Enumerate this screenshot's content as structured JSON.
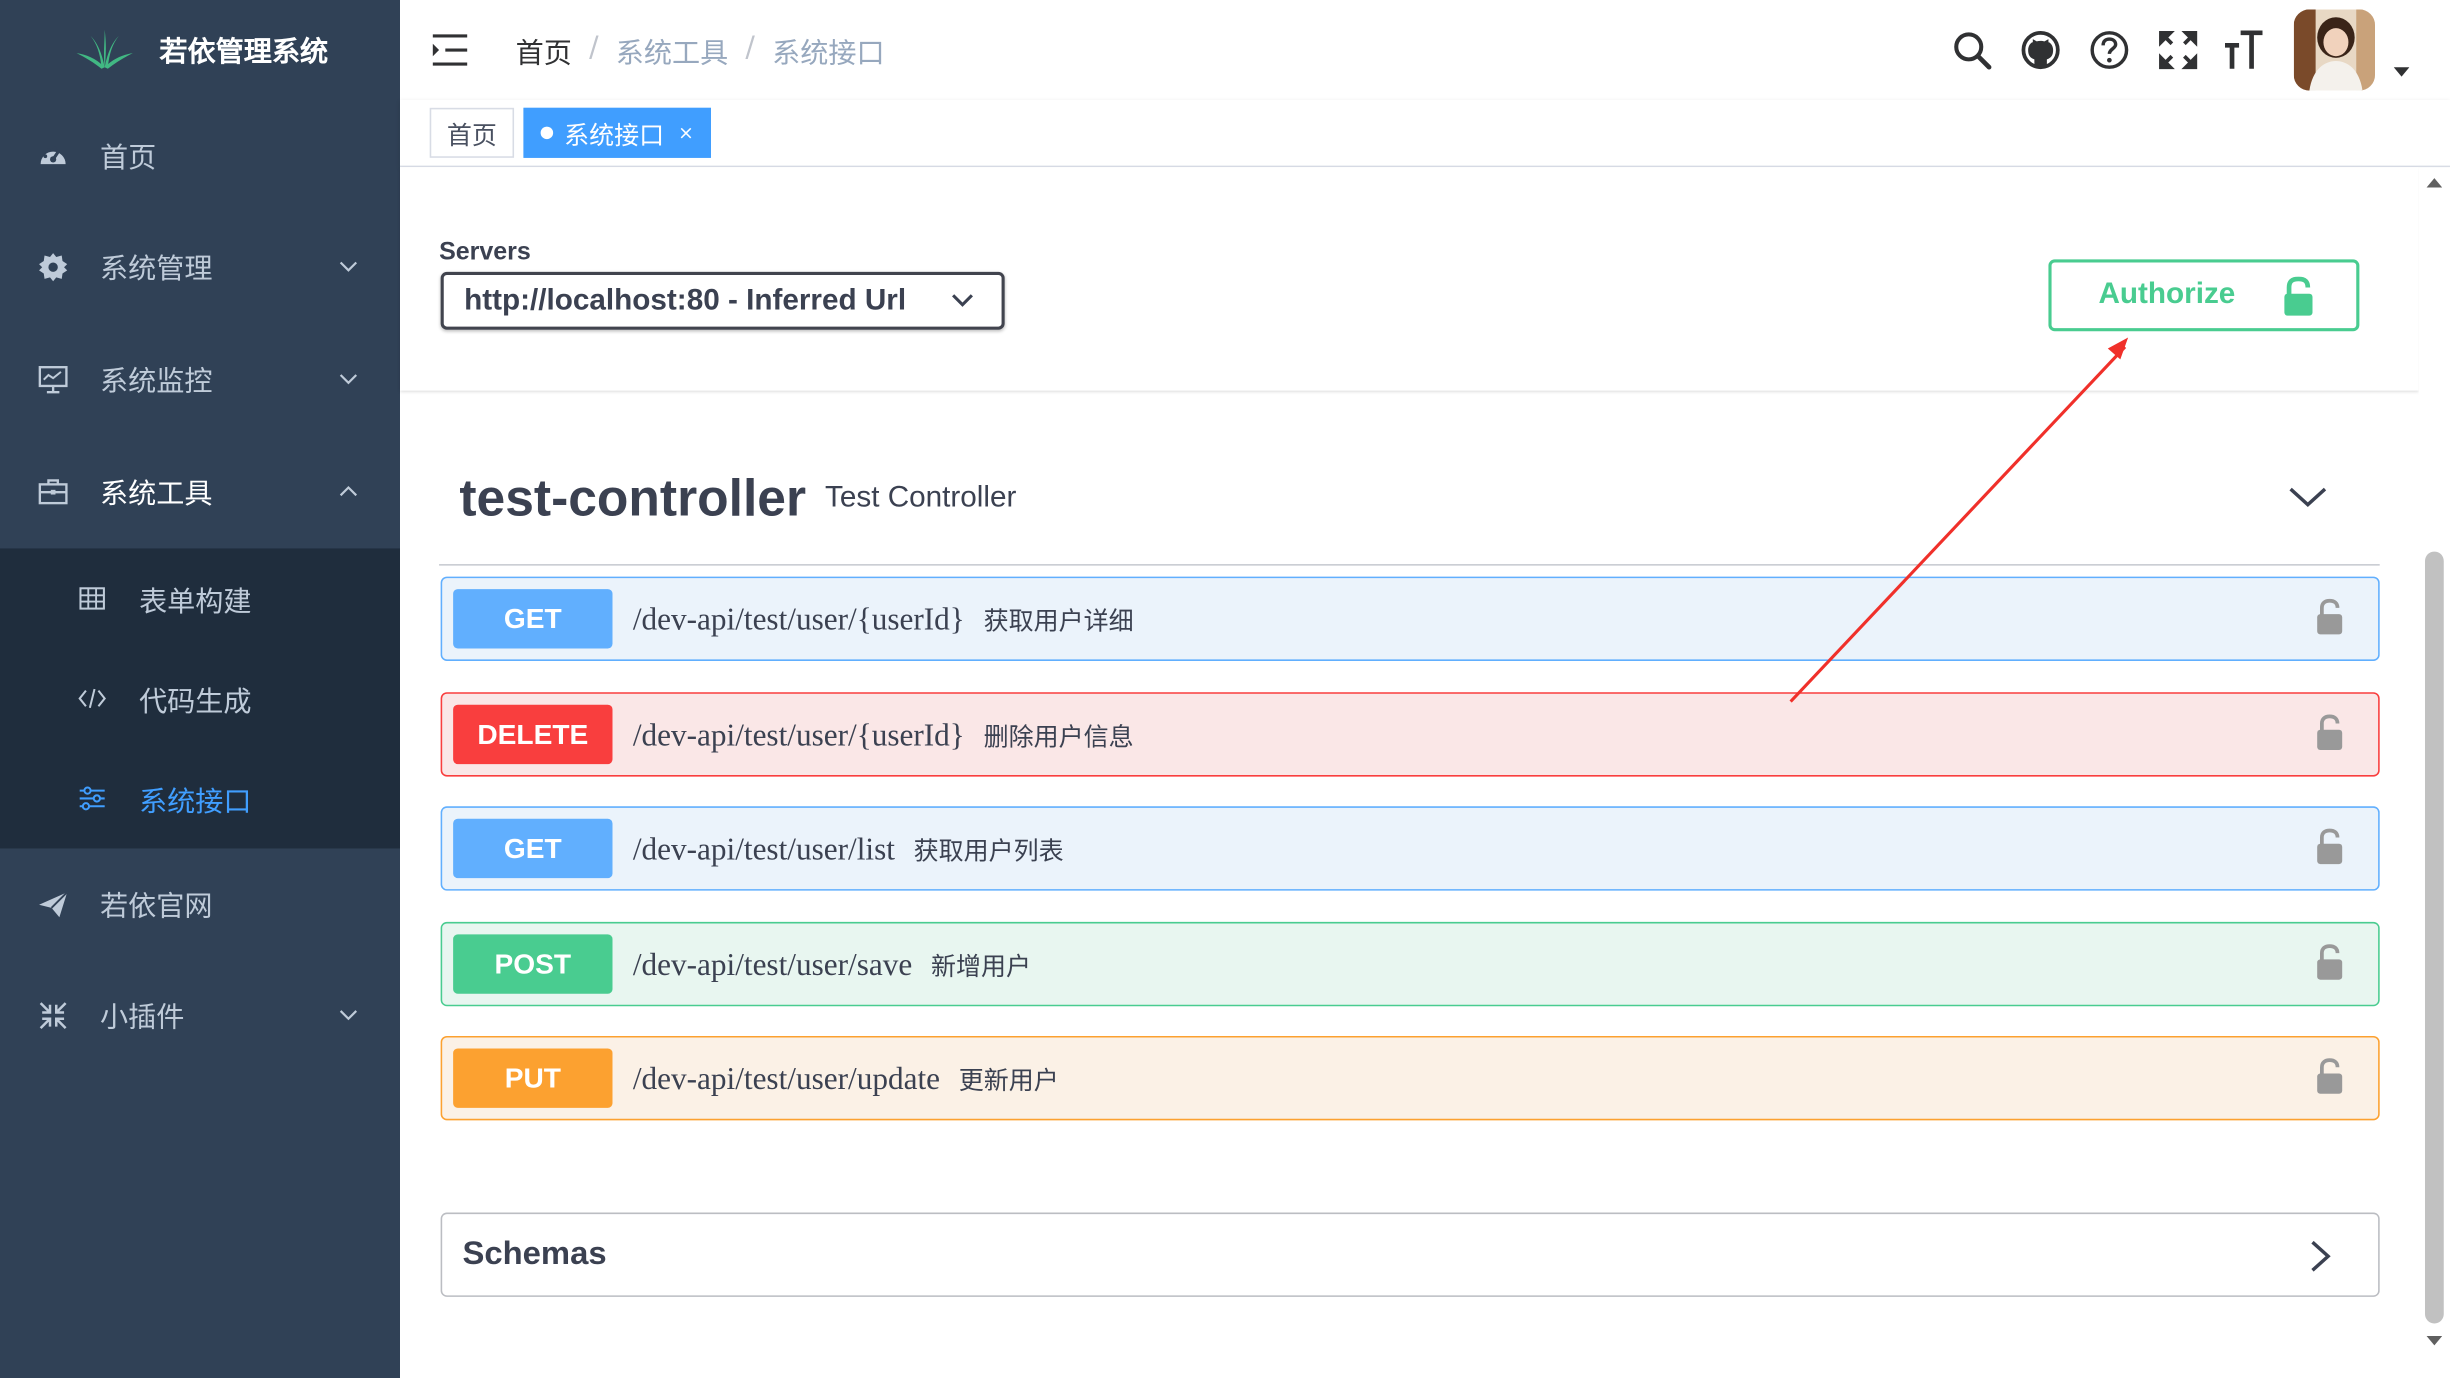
{
  "app": {
    "title": "若依管理系统"
  },
  "sidebar": {
    "items": [
      {
        "label": "首页",
        "icon": "dashboard-icon"
      },
      {
        "label": "系统管理",
        "icon": "gear-icon"
      },
      {
        "label": "系统监控",
        "icon": "monitor-icon"
      },
      {
        "label": "系统工具",
        "icon": "toolbox-icon"
      },
      {
        "label": "若依官网",
        "icon": "paper-plane-icon"
      },
      {
        "label": "小插件",
        "icon": "expand-icon"
      }
    ],
    "tool_children": [
      {
        "label": "表单构建",
        "icon": "table-icon"
      },
      {
        "label": "代码生成",
        "icon": "code-icon"
      },
      {
        "label": "系统接口",
        "icon": "sliders-icon",
        "active": true
      }
    ],
    "active_color": "#409eff",
    "bg_color": "#304156"
  },
  "navbar": {
    "breadcrumb": [
      "首页",
      "系统工具",
      "系统接口"
    ],
    "icons": [
      "search-icon",
      "github-icon",
      "help-icon",
      "fullscreen-icon",
      "font-size-icon"
    ]
  },
  "tags": [
    {
      "label": "首页",
      "active": false
    },
    {
      "label": "系统接口",
      "active": true,
      "close": "×"
    }
  ],
  "swagger": {
    "servers_label": "Servers",
    "server_selected": "http://localhost:80 - Inferred Url",
    "authorize_label": "Authorize",
    "controller": {
      "name": "test-controller",
      "description": "Test Controller"
    },
    "operations": [
      {
        "method": "GET",
        "path": "/dev-api/test/user/{userId}",
        "summary": "获取用户详细",
        "color": "#61affe"
      },
      {
        "method": "DELETE",
        "path": "/dev-api/test/user/{userId}",
        "summary": "删除用户信息",
        "color": "#f93e3e"
      },
      {
        "method": "GET",
        "path": "/dev-api/test/user/list",
        "summary": "获取用户列表",
        "color": "#61affe"
      },
      {
        "method": "POST",
        "path": "/dev-api/test/user/save",
        "summary": "新增用户",
        "color": "#49cc90"
      },
      {
        "method": "PUT",
        "path": "/dev-api/test/user/update",
        "summary": "更新用户",
        "color": "#fca130"
      }
    ],
    "schemas_label": "Schemas"
  }
}
